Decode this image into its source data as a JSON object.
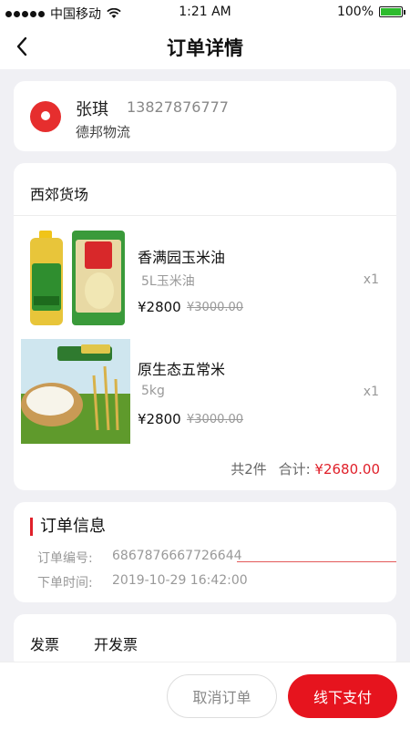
{
  "status": {
    "carrier": "中国移动",
    "time": "1:21 AM",
    "battery": "100%"
  },
  "nav": {
    "title": "订单详情"
  },
  "address": {
    "name": "张琪",
    "phone": "13827876777",
    "company": "德邦物流"
  },
  "store": {
    "name": "西郊货场"
  },
  "items": [
    {
      "name": "香满园玉米油",
      "spec": "5L玉米油",
      "qty": "x1",
      "price": "¥2800",
      "old_price": "¥3000.00"
    },
    {
      "name": "原生态五常米",
      "spec": "5kg",
      "qty": "x1",
      "price": "¥2800",
      "old_price": "¥3000.00"
    }
  ],
  "summary": {
    "count": "共2件",
    "total_label": "合计:",
    "total": "¥2680.00"
  },
  "order_info": {
    "title": "订单信息",
    "number_label": "订单编号:",
    "number": "6867876667726644",
    "time_label": "下单时间:",
    "time": "2019-10-29 16:42:00"
  },
  "invoice": {
    "label": "发票",
    "value": "开发票"
  },
  "actions": {
    "cancel": "取消订单",
    "pay": "线下支付"
  },
  "colors": {
    "accent": "#e6141e",
    "background": "#f0f0f4"
  }
}
